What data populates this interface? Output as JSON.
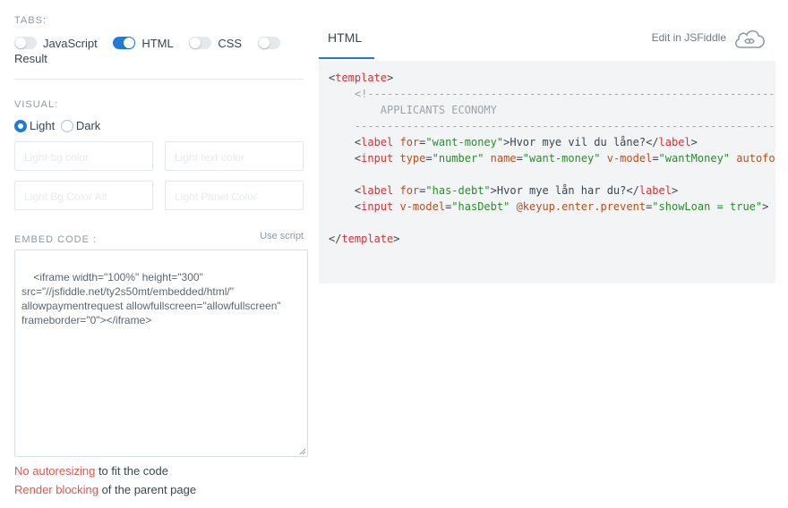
{
  "tabs_section": {
    "title": "TABS:",
    "toggles": [
      {
        "label": "JavaScript",
        "on": false
      },
      {
        "label": "HTML",
        "on": true
      },
      {
        "label": "CSS",
        "on": false
      },
      {
        "label": "Result",
        "on": false
      }
    ]
  },
  "visual_section": {
    "title": "VISUAL:",
    "options": [
      {
        "label": "Light",
        "selected": true
      },
      {
        "label": "Dark",
        "selected": false
      }
    ]
  },
  "fields": {
    "f1": "Light bg color",
    "f2": "Light text color",
    "f3": "Light Bg Color Alt",
    "f4": "Light Panel Color"
  },
  "embed": {
    "title": "EMBED CODE :",
    "use_script": "Use script",
    "code": "<iframe width=\"100%\" height=\"300\"\nsrc=\"//jsfiddle.net/ty2s50mt/embedded/html/\"\nallowpaymentrequest allowfullscreen=\"allowfullscreen\"\nframeborder=\"0\"></iframe>"
  },
  "notes": {
    "n1_red": "No autoresizing",
    "n1_rest": " to fit the code",
    "n2_red": "Render blocking",
    "n2_rest": " of the parent page"
  },
  "preview": {
    "tab_label": "HTML",
    "edit_link": "Edit in JSFiddle",
    "code": {
      "l1_tag": "template",
      "l2_comment": "<!-----------------------------------------------------------------------------",
      "l3_comment": "    APPLICANTS ECONOMY",
      "l4_comment": "--------------------------------------------------------------------------------",
      "l5_for": "\"want-money\"",
      "l5_text": "Hvor mye vil du låne?",
      "l6_type": "\"number\"",
      "l6_name": "\"want-money\"",
      "l6_vmodel": "\"wantMoney\"",
      "l6_more": "autofocu",
      "l8_for": "\"has-debt\"",
      "l8_text": "Hvor mye lån har du?",
      "l9_vmodel": "\"hasDebt\"",
      "l9_event": "@keyup.enter.prevent",
      "l9_val": "\"showLoan = true\"",
      "l11_tag": "template"
    }
  },
  "colors": {
    "accent": "#1f7bd8",
    "link_red": "#e4564c",
    "code_bg": "#f3f4f5",
    "tag": "#d1333a",
    "attr": "#b3501f",
    "value": "#2b8a2e"
  }
}
